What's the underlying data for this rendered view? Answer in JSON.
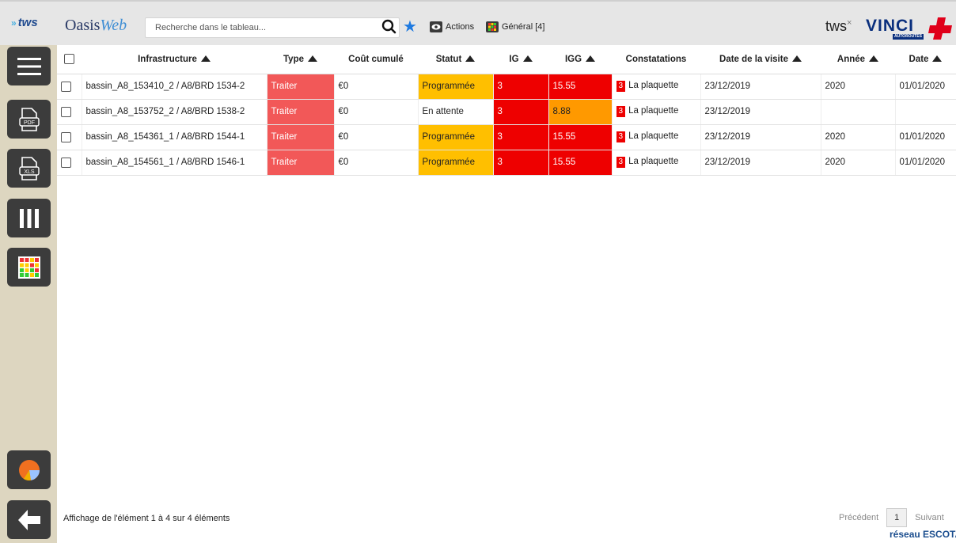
{
  "header": {
    "logo_tws": "tws",
    "logo_oasis_a": "Oasis",
    "logo_oasis_b": "Web",
    "search_placeholder": "Recherche dans le tableau...",
    "actions_label": "Actions",
    "general_label": "Général [4]",
    "brand_tws": "tws",
    "brand_x": "×",
    "brand_vinci": "VINCI",
    "brand_autoroutes": "AUTOROUTES"
  },
  "sidebar": {
    "items": [
      "menu-icon",
      "pdf-export-icon",
      "xls-export-icon",
      "columns-icon",
      "color-grid-icon"
    ],
    "bottom": [
      "pie-chart-icon",
      "back-arrow-icon"
    ]
  },
  "table": {
    "columns": [
      "Infrastructure",
      "Type",
      "Coût cumulé",
      "Statut",
      "IG",
      "IGG",
      "Constatations",
      "Date de la visite",
      "Année",
      "Date"
    ],
    "rows": [
      {
        "infrastructure": "bassin_A8_153410_2 / A8/BRD 1534-2",
        "type": "Traiter",
        "cout": "€0",
        "statut": "Programmée",
        "ig": "3",
        "igg": "15.55",
        "constat_count": "3",
        "constat_label": "La plaquette",
        "date_visite": "23/12/2019",
        "annee": "2020",
        "date": "01/01/2020"
      },
      {
        "infrastructure": "bassin_A8_153752_2 / A8/BRD 1538-2",
        "type": "Traiter",
        "cout": "€0",
        "statut": "En attente",
        "ig": "3",
        "igg": "8.88",
        "constat_count": "3",
        "constat_label": "La plaquette",
        "date_visite": "23/12/2019",
        "annee": "",
        "date": ""
      },
      {
        "infrastructure": "bassin_A8_154361_1 / A8/BRD 1544-1",
        "type": "Traiter",
        "cout": "€0",
        "statut": "Programmée",
        "ig": "3",
        "igg": "15.55",
        "constat_count": "3",
        "constat_label": "La plaquette",
        "date_visite": "23/12/2019",
        "annee": "2020",
        "date": "01/01/2020"
      },
      {
        "infrastructure": "bassin_A8_154561_1 / A8/BRD 1546-1",
        "type": "Traiter",
        "cout": "€0",
        "statut": "Programmée",
        "ig": "3",
        "igg": "15.55",
        "constat_count": "3",
        "constat_label": "La plaquette",
        "date_visite": "23/12/2019",
        "annee": "2020",
        "date": "01/01/2020"
      }
    ]
  },
  "footer": {
    "info": "Affichage de l'élément 1 à 4 sur 4 éléments",
    "prev": "Précédent",
    "page": "1",
    "next": "Suivant",
    "network": "réseau ESCOTA"
  },
  "colors": {
    "danger": "#ee0000",
    "soft_danger": "#f25858",
    "warning": "#ffbf00",
    "orange": "#ff9900",
    "brand": "#0a2f7d"
  }
}
